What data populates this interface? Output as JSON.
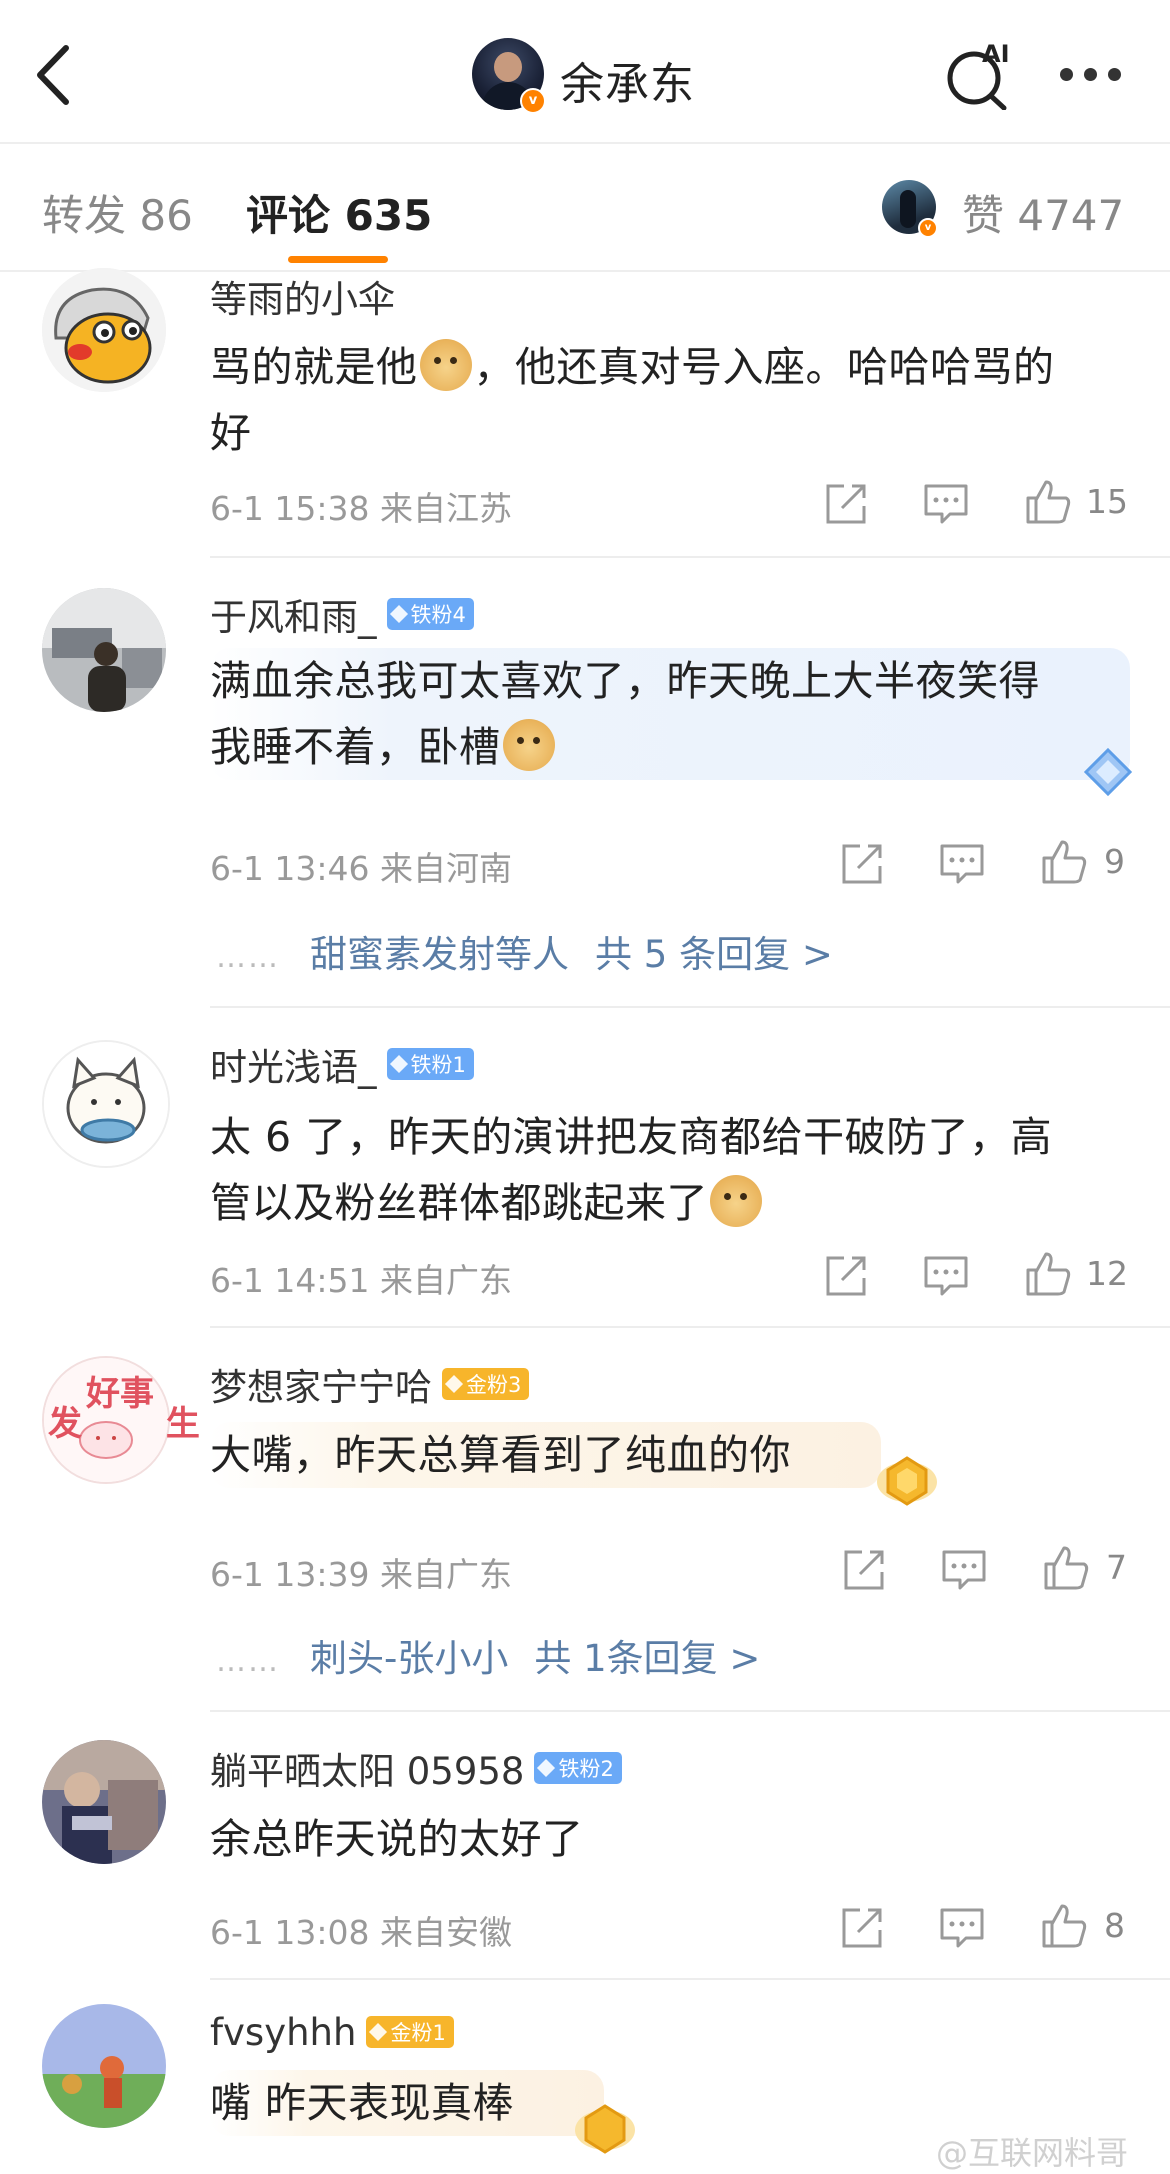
{
  "header": {
    "title": "余承东",
    "ai_label": "AI"
  },
  "tabs": {
    "forward": "转发 86",
    "comment": "评论 635",
    "likes": "赞 4747"
  },
  "colors": {
    "accent": "#ff8200",
    "link": "#5a7da6",
    "iron_badge": "#6aa9f7",
    "gold_badge": "#f7b52b"
  },
  "comments": [
    {
      "username": "等雨的小伞",
      "text_before": "骂的就是他",
      "text_after": "，他还真对号入座。哈哈哈骂的",
      "text_line2": "好",
      "meta": "6-1 15:38 来自江苏",
      "likes": "15"
    },
    {
      "username": "于风和雨_",
      "badge": "铁粉4",
      "text_line1": "满血余总我可太喜欢了，昨天晚上大半夜笑得",
      "text_line2": "我睡不着，卧槽",
      "meta": "6-1 13:46 来自河南",
      "likes": "9",
      "replies_dots": "……",
      "replies_name": "甜蜜素发射",
      "replies_mid": "等人",
      "replies_count": "共 5 条回复 >"
    },
    {
      "username": "时光浅语_",
      "badge": "铁粉1",
      "text_line1": "太 6 了，昨天的演讲把友商都给干破防了，高",
      "text_line2": "管以及粉丝群体都跳起来了",
      "meta": "6-1 14:51 来自广东",
      "likes": "12"
    },
    {
      "username": "梦想家宁宁哈",
      "badge": "金粉3",
      "avatar_text1": "好事",
      "avatar_text2": "发 生",
      "text_line1": "大嘴，昨天总算看到了纯血的你",
      "meta": "6-1 13:39 来自广东",
      "likes": "7",
      "replies_dots": "……",
      "replies_name": "刺头-张小小",
      "replies_count": "共 1条回复 >"
    },
    {
      "username": "躺平晒太阳 05958",
      "badge": "铁粉2",
      "text_line1": "余总昨天说的太好了",
      "meta": "6-1 13:08 来自安徽",
      "likes": "8"
    },
    {
      "username": "fvsyhhh",
      "badge": "金粉1",
      "text_line1": "嘴 昨天表现真棒"
    }
  ],
  "watermark": "@互联网料哥",
  "icons": [
    "back-icon",
    "ai-search-icon",
    "more-icon",
    "share-icon",
    "comment-icon",
    "like-icon",
    "doge-emoji"
  ]
}
